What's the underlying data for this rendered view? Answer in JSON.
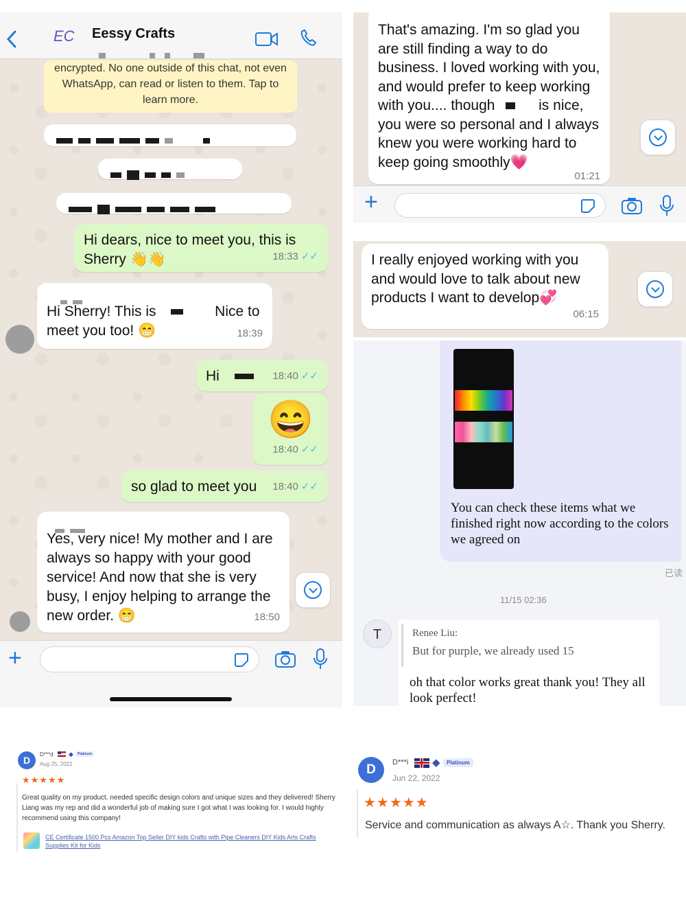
{
  "whatsapp_main": {
    "contact_name": "Eessy Crafts",
    "logo_text": "EC",
    "encryption_notice": "encrypted. No one outside of this chat, not even WhatsApp, can read or listen to them. Tap to learn more.",
    "messages": [
      {
        "dir": "out",
        "text": "Hi dears, nice to meet you, this is Sherry 👋👋",
        "time": "18:33"
      },
      {
        "dir": "in",
        "text": "Hi Sherry! This is",
        "text_after": "Nice to meet you too! 😁",
        "time": "18:39"
      },
      {
        "dir": "out",
        "text": "Hi",
        "time": "18:40"
      },
      {
        "dir": "out",
        "text": "😄",
        "time": "18:40"
      },
      {
        "dir": "out",
        "text": "so glad to meet you",
        "time": "18:40"
      },
      {
        "dir": "in",
        "text": "Yes, very nice! My mother and I are always so happy with your good service! And now that she is very busy, I enjoy helping to arrange the new order. 😁",
        "time": "18:50"
      }
    ],
    "icons": [
      "back-chevron-icon",
      "video-call-icon",
      "phone-call-icon",
      "plus-icon",
      "sticker-icon",
      "camera-icon",
      "microphone-icon",
      "scroll-down-icon"
    ]
  },
  "whatsapp_snippet_1": {
    "text_before": "That's amazing. I'm so glad you are still finding a way to do business. I loved working with you, and would prefer to keep working with you.... though",
    "text_after": "is nice, you were so personal and I always knew you were working hard to keep going smoothly💗",
    "time": "01:21"
  },
  "whatsapp_snippet_2": {
    "text": "I really enjoyed working with you and would love to talk about new products I want to develop💞",
    "time": "06:15"
  },
  "other_chat": {
    "sent_message": "You can check these items what we finished right now according to the colors we agreed on",
    "read_status": "已读",
    "timestamp": "11/15 02:36",
    "reply_avatar": "T",
    "quoted_author": "Renee Liu:",
    "quoted_text": "But for purple, we already used 15",
    "reply_text": "oh that color works great thank you! They all look perfect!"
  },
  "reviews": [
    {
      "initial": "D",
      "name": "D***d",
      "flag": "US",
      "badge": "Platinum",
      "date": "Aug 25, 2022",
      "stars": "★★★★★",
      "text": "Great quality on my product. needed specific design colors and unique sizes and they delivered! Sherry Liang was my rep and did a wonderful job of making sure I got what I was looking for. I would highly recommend using this company!",
      "product_link": "CE Certificate 1500 Pcs Amazon Top Seller DIY kids Crafts with Pipe Cleaners DIY Kids Arts Crafts Supplies Kit for Kids"
    },
    {
      "initial": "D",
      "name": "D***i",
      "flag": "UK",
      "badge": "Platinum",
      "date": "Jun 22, 2022",
      "stars": "★★★★★",
      "text": "Service and communication as always A☆. Thank you Sherry."
    }
  ],
  "colors": {
    "chat_bg": "#ece5dd",
    "out_bubble": "#dcf8c6",
    "in_bubble": "#ffffff",
    "accent_blue": "#1e7bd7",
    "star_orange": "#f26a1b",
    "notice_yellow": "#fff5c4"
  }
}
